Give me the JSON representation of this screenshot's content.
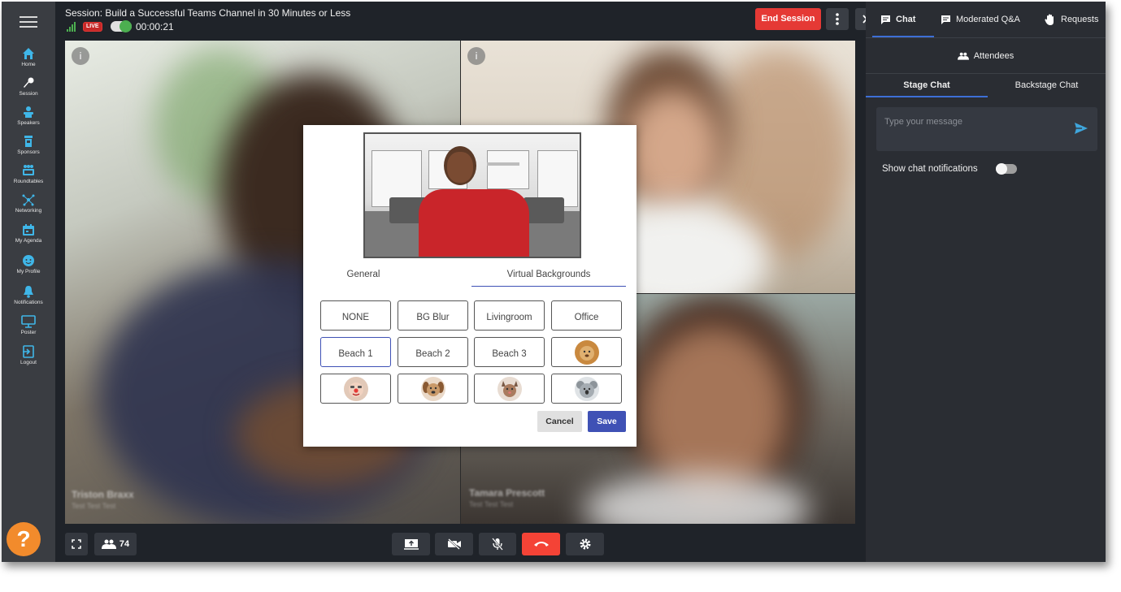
{
  "session": {
    "title": "Session: Build a Successful Teams Channel in 30 Minutes or Less",
    "live_label": "LIVE",
    "timer": "00:00:21",
    "end_session_label": "End Session"
  },
  "nav": {
    "items": [
      {
        "label": "Home",
        "icon": "home-icon"
      },
      {
        "label": "Session",
        "icon": "microphone-icon"
      },
      {
        "label": "Speakers",
        "icon": "speaker-icon"
      },
      {
        "label": "Sponsors",
        "icon": "sponsor-icon"
      },
      {
        "label": "Roundtables",
        "icon": "roundtable-icon"
      },
      {
        "label": "Networking",
        "icon": "network-icon"
      },
      {
        "label": "My Agenda",
        "icon": "calendar-icon"
      },
      {
        "label": "My Profile",
        "icon": "profile-icon"
      },
      {
        "label": "Notifications",
        "icon": "bell-icon"
      },
      {
        "label": "Poster",
        "icon": "poster-icon"
      },
      {
        "label": "Logout",
        "icon": "logout-icon"
      }
    ],
    "help_label": "?"
  },
  "video": {
    "tiles": [
      {
        "name": "Triston Braxx",
        "subtitle": "Test Test Test"
      },
      {
        "name": "",
        "subtitle": ""
      },
      {
        "name": "Tamara Prescott",
        "subtitle": "Test Test Test"
      }
    ]
  },
  "controls": {
    "attendee_count": "74"
  },
  "right_panel": {
    "tabs": {
      "chat": "Chat",
      "qa": "Moderated Q&A",
      "requests": "Requests"
    },
    "attendees_label": "Attendees",
    "chat_tabs": {
      "stage": "Stage Chat",
      "backstage": "Backstage Chat"
    },
    "message_placeholder": "Type your message",
    "notifications_label": "Show chat notifications"
  },
  "modal": {
    "tabs": {
      "general": "General",
      "virtual": "Virtual Backgrounds"
    },
    "options": {
      "none": "NONE",
      "blur": "BG Blur",
      "livingroom": "Livingroom",
      "office": "Office",
      "beach1": "Beach 1",
      "beach2": "Beach 2",
      "beach3": "Beach 3"
    },
    "cancel_label": "Cancel",
    "save_label": "Save"
  },
  "colors": {
    "accent": "#3f51b5",
    "end_session": "#e53935",
    "hangup": "#f44336",
    "help": "#f28b2c"
  }
}
